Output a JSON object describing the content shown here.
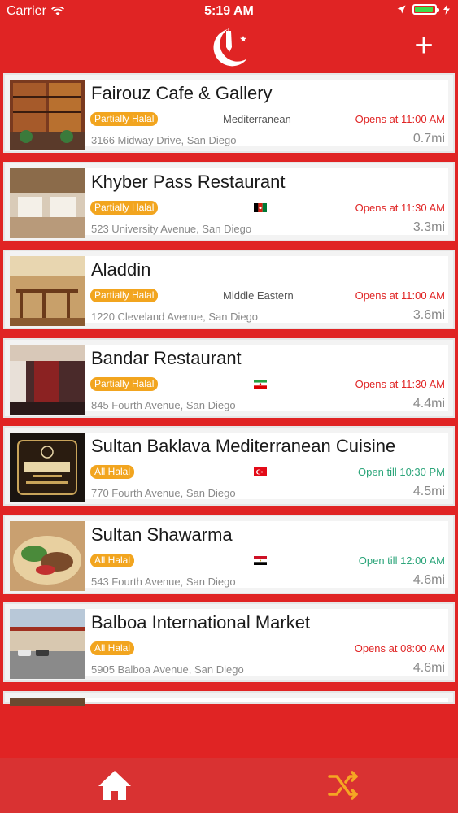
{
  "status": {
    "carrier": "Carrier",
    "time": "5:19 AM"
  },
  "nav": {
    "add_label": "+"
  },
  "restaurants": [
    {
      "name": "Fairouz Cafe & Gallery",
      "badge": "Partially Halal",
      "cuisine": "Mediterranean",
      "flag": "",
      "hours": "Opens at 11:00 AM",
      "hours_state": "closed",
      "address": "3166 Midway Drive, San Diego",
      "distance": "0.7mi"
    },
    {
      "name": "Khyber Pass Restaurant",
      "badge": "Partially Halal",
      "cuisine": "",
      "flag": "afghanistan-flag-icon",
      "hours": "Opens at 11:30 AM",
      "hours_state": "closed",
      "address": "523 University Avenue, San Diego",
      "distance": "3.3mi"
    },
    {
      "name": "Aladdin",
      "badge": "Partially Halal",
      "cuisine": "Middle Eastern",
      "flag": "",
      "hours": "Opens at 11:00 AM",
      "hours_state": "closed",
      "address": "1220 Cleveland Avenue, San Diego",
      "distance": "3.6mi"
    },
    {
      "name": "Bandar Restaurant",
      "badge": "Partially Halal",
      "cuisine": "",
      "flag": "iran-flag-icon",
      "hours": "Opens at 11:30 AM",
      "hours_state": "closed",
      "address": "845 Fourth Avenue, San Diego",
      "distance": "4.4mi"
    },
    {
      "name": "Sultan Baklava Mediterranean Cuisine",
      "badge": "All Halal",
      "cuisine": "",
      "flag": "turkey-flag-icon",
      "hours": "Open till 10:30 PM",
      "hours_state": "open",
      "address": "770 Fourth Avenue, San Diego",
      "distance": "4.5mi"
    },
    {
      "name": "Sultan Shawarma",
      "badge": "All Halal",
      "cuisine": "",
      "flag": "egypt-flag-icon",
      "hours": "Open till 12:00 AM",
      "hours_state": "open",
      "address": "543 Fourth Avenue, San Diego",
      "distance": "4.6mi"
    },
    {
      "name": "Balboa International Market",
      "badge": "All Halal",
      "cuisine": "",
      "flag": "",
      "hours": "Opens at 08:00 AM",
      "hours_state": "closed",
      "address": "5905 Balboa Avenue, San Diego",
      "distance": "4.6mi"
    }
  ],
  "colors": {
    "brand_red": "#e02424",
    "badge_orange": "#f2a51f",
    "open_green": "#2ca57a",
    "tab_active": "#f5a623"
  }
}
